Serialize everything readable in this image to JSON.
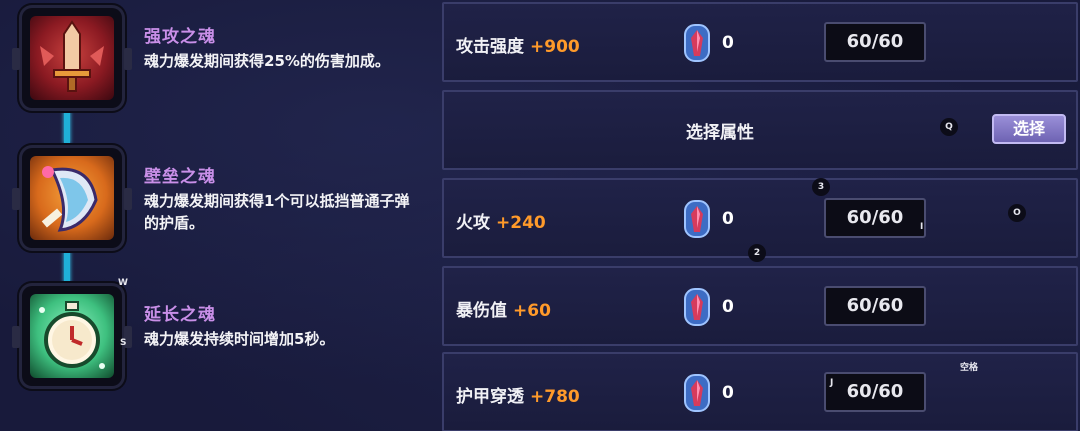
{
  "skills": [
    {
      "name": "强攻之魂",
      "desc": "魂力爆发期间获得25%的伤害加成。",
      "icon": "sword-icon",
      "color": "#c8413e"
    },
    {
      "name": "壁垒之魂",
      "desc": "魂力爆发期间获得1个可以抵挡普通子弹的护盾。",
      "icon": "shield-icon",
      "color": "#f5a13b"
    },
    {
      "name": "延长之魂",
      "desc": "魂力爆发持续时间增加5秒。",
      "icon": "stopwatch-icon",
      "color": "#3ec07f"
    }
  ],
  "key_hints": {
    "w": "W",
    "s": "S",
    "q": "Q",
    "o": "O",
    "num2": "2",
    "num3": "3",
    "space": "空格",
    "i_mark": "I",
    "j_mark": "J"
  },
  "attributes": [
    {
      "label": "攻击强度",
      "bonus": "+900",
      "count": "0",
      "value": "60/60"
    },
    {
      "label": "火攻",
      "bonus": "+240",
      "count": "0",
      "value": "60/60"
    },
    {
      "label": "暴伤值",
      "bonus": "+60",
      "count": "0",
      "value": "60/60"
    },
    {
      "label": "护甲穿透",
      "bonus": "+780",
      "count": "0",
      "value": "60/60"
    }
  ],
  "select_row": {
    "text": "选择属性",
    "button": "选择"
  },
  "colors": {
    "bonus": "#ff9a2a",
    "skill_name": "#c98fe8",
    "connector": "#1fb0d8",
    "button": "#8a7fd0"
  }
}
